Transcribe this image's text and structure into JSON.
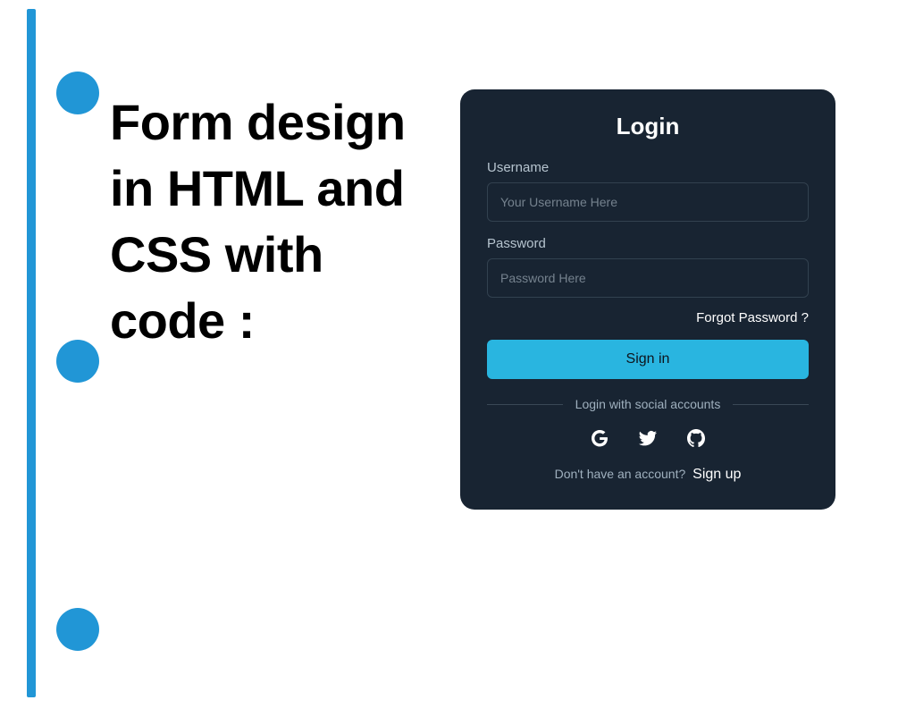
{
  "headline": "Form design in HTML and CSS with code :",
  "card": {
    "title": "Login",
    "username_label": "Username",
    "username_placeholder": "Your Username Here",
    "password_label": "Password",
    "password_placeholder": "Password Here",
    "forgot": "Forgot Password ?",
    "signin": "Sign in",
    "social_text": "Login with social accounts",
    "signup_prompt": "Don't have an account?",
    "signup_link": "Sign up"
  },
  "colors": {
    "accent": "#2196d6",
    "card_bg": "#182432",
    "button": "#29b5e0"
  }
}
